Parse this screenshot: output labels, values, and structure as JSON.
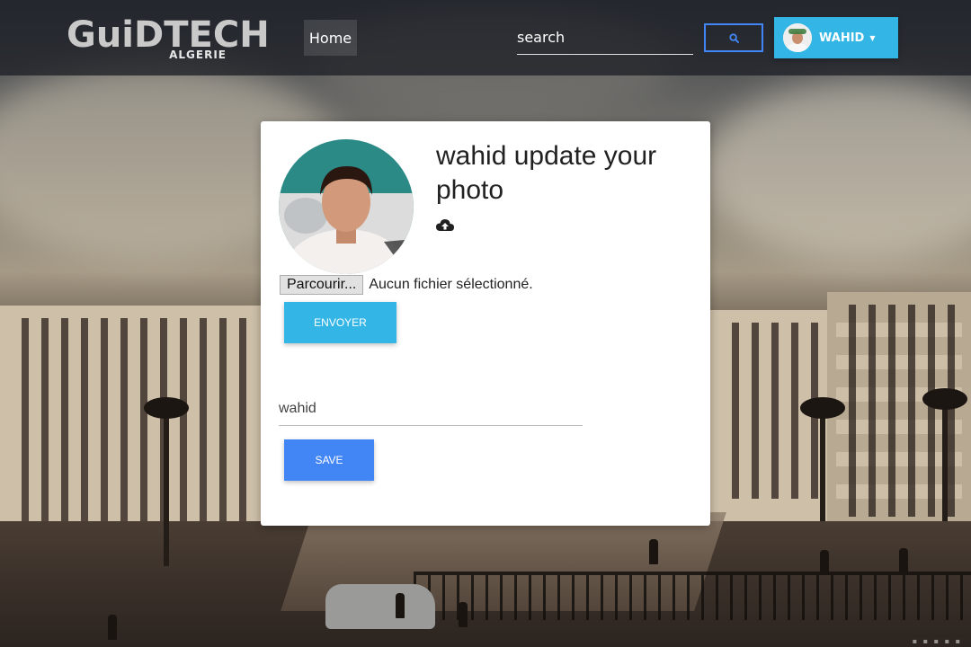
{
  "navbar": {
    "logo_main": "GuiDTECH",
    "logo_sub": "ALGERIE",
    "home_label": "Home",
    "search_placeholder": "search",
    "search_icon": "search-icon",
    "user_name": "WAHID",
    "user_caret_icon": "caret-down-icon"
  },
  "profile": {
    "title": "wahid update your photo",
    "upload_icon": "cloud-upload-icon",
    "file_button_label": "Parcourir...",
    "file_status": "Aucun fichier sélectionné.",
    "envoyer_label": "ENVOYER",
    "name_value": "wahid",
    "save_label": "SAVE"
  },
  "colors": {
    "primary": "#4285f4",
    "info": "#33b5e5",
    "card": "#ffffff"
  }
}
